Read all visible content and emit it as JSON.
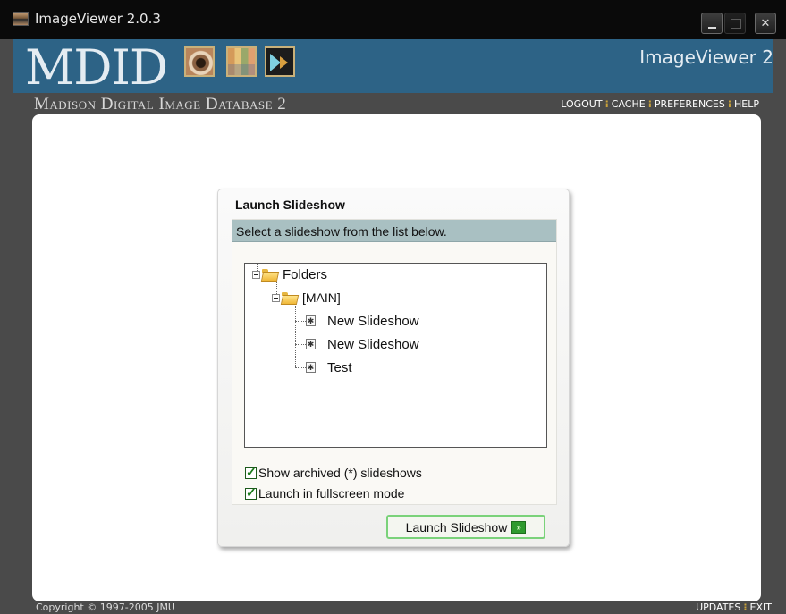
{
  "window": {
    "title": "ImageViewer 2.0.3",
    "controls": {
      "minimize_icon": "minimize-icon",
      "maximize_icon": "maximize-icon",
      "close_label": "✕"
    }
  },
  "header": {
    "logo_text": "MDID",
    "app_name": "ImageViewer 2",
    "subtitle": "Madison Digital Image Database 2",
    "nav": [
      "LOGOUT",
      "CACHE",
      "PREFERENCES",
      "HELP"
    ],
    "nav_separator": "⁝"
  },
  "dialog": {
    "title": "Launch Slideshow",
    "instruction": "Select a slideshow from the list below.",
    "tree": {
      "root_label": "Folders",
      "folder_label": "[MAIN]",
      "items": [
        "New Slideshow",
        "New Slideshow",
        "Test"
      ]
    },
    "options": [
      {
        "label": "Show archived (*) slideshows",
        "checked": true
      },
      {
        "label": "Launch in fullscreen mode",
        "checked": true
      }
    ],
    "launch_button": "Launch Slideshow",
    "launch_icon_glyph": "»"
  },
  "footer": {
    "copyright": "Copyright © 1997-2005 JMU",
    "nav": [
      "UPDATES",
      "EXIT"
    ]
  },
  "colors": {
    "banner": "#2d6386",
    "instruction_bar": "#a9c0c2",
    "button_border": "#7ad27a",
    "separator": "#c9a23a"
  }
}
